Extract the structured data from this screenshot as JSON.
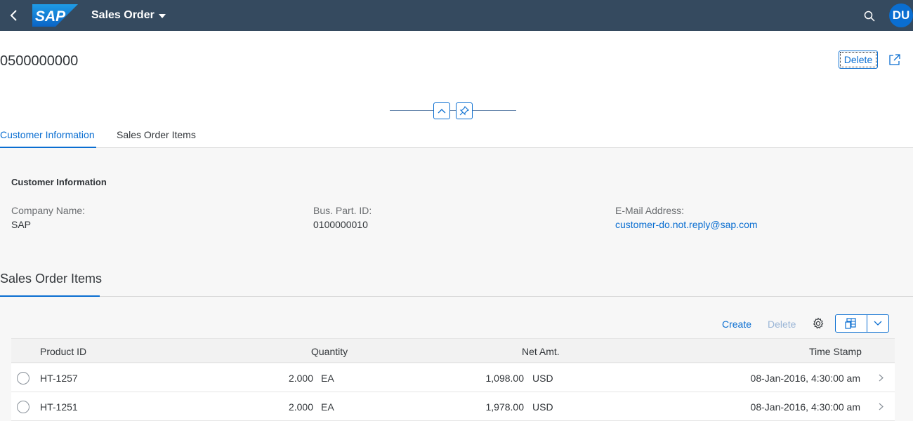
{
  "shell": {
    "logo_text": "SAP",
    "app_title": "Sales Order",
    "avatar_initials": "DU"
  },
  "header": {
    "object_id": "0500000000",
    "delete_label": "Delete"
  },
  "tabs": [
    {
      "label": "Customer Information",
      "active": true
    },
    {
      "label": "Sales Order Items",
      "active": false
    }
  ],
  "customer_section": {
    "title": "Customer Information",
    "fields": [
      {
        "label": "Company Name:",
        "value": "SAP"
      },
      {
        "label": "Bus. Part. ID:",
        "value": "0100000010"
      },
      {
        "label": "E-Mail Address:",
        "value": "customer-do.not.reply@sap.com"
      }
    ]
  },
  "items_section": {
    "title": "Sales Order Items",
    "toolbar": {
      "create_label": "Create",
      "delete_label": "Delete"
    },
    "columns": [
      "Product ID",
      "Quantity",
      "Net Amt.",
      "Time Stamp"
    ],
    "rows": [
      {
        "product_id": "HT-1257",
        "quantity": "2.000",
        "qty_unit": "EA",
        "net_amt": "1,098.00",
        "currency": "USD",
        "timestamp": "08-Jan-2016, 4:30:00 am"
      },
      {
        "product_id": "HT-1251",
        "quantity": "2.000",
        "qty_unit": "EA",
        "net_amt": "1,978.00",
        "currency": "USD",
        "timestamp": "08-Jan-2016, 4:30:00 am"
      }
    ]
  },
  "colors": {
    "shell_bg": "#354a5f",
    "accent": "#0a6ed1",
    "avatar_bg": "#0a6ed1"
  },
  "icons": [
    "back-arrow-icon",
    "dropdown-caret-icon",
    "search-icon",
    "share-icon",
    "collapse-up-icon",
    "pin-icon",
    "settings-gear-icon",
    "export-spreadsheet-icon",
    "chevron-down-icon",
    "chevron-right-icon"
  ]
}
